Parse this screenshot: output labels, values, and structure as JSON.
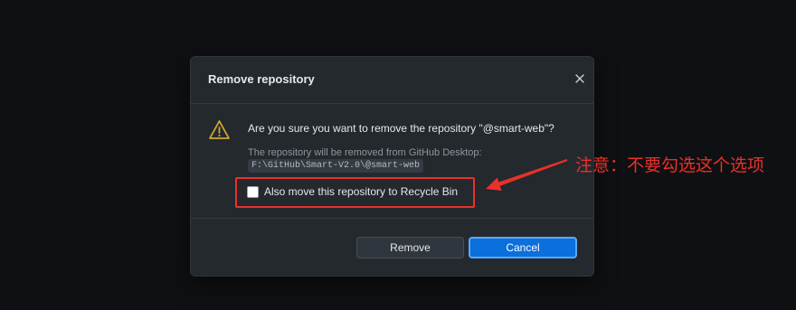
{
  "dialog": {
    "title": "Remove repository",
    "close_icon": "close-icon",
    "warning_icon": "warning-icon",
    "message": "Are you sure you want to remove the repository \"@smart-web\"?",
    "detail": "The repository will be removed from GitHub Desktop:",
    "path": "F:\\GitHub\\Smart-V2.0\\@smart-web",
    "checkbox": {
      "label": "Also move this repository to Recycle Bin",
      "checked": false
    },
    "buttons": {
      "remove_label": "Remove",
      "cancel_label": "Cancel"
    }
  },
  "annotation": {
    "note": "注意：不要勾选这个选项",
    "arrow_icon": "arrow-icon"
  },
  "colors": {
    "page_bg": "#0f1013",
    "dialog_bg": "#24292e",
    "accent": "#0b6fdc",
    "warning": "#d4a72c",
    "annotation": "#e8312a"
  }
}
